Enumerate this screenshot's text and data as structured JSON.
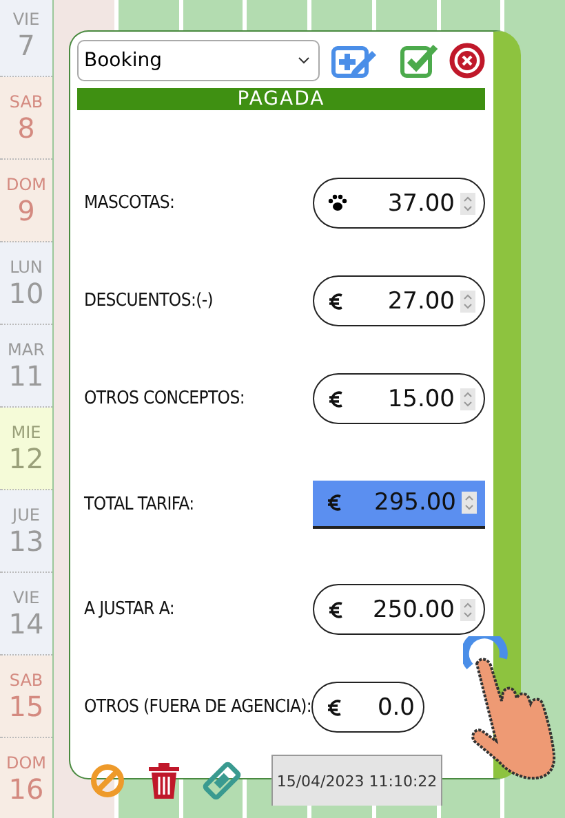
{
  "calendar": {
    "days": [
      {
        "weekday": "VIE",
        "number": "7",
        "kind": "weekday"
      },
      {
        "weekday": "SAB",
        "number": "8",
        "kind": "weekend"
      },
      {
        "weekday": "DOM",
        "number": "9",
        "kind": "weekend"
      },
      {
        "weekday": "LUN",
        "number": "10",
        "kind": "weekday"
      },
      {
        "weekday": "MAR",
        "number": "11",
        "kind": "weekday"
      },
      {
        "weekday": "MIE",
        "number": "12",
        "kind": "today"
      },
      {
        "weekday": "JUE",
        "number": "13",
        "kind": "weekday"
      },
      {
        "weekday": "VIE",
        "number": "14",
        "kind": "weekday"
      },
      {
        "weekday": "SAB",
        "number": "15",
        "kind": "weekend"
      },
      {
        "weekday": "DOM",
        "number": "16",
        "kind": "weekend"
      }
    ]
  },
  "dialog": {
    "source": {
      "value": "Booking"
    },
    "status": "PAGADA",
    "fields": [
      {
        "label": "MASCOTAS:",
        "value": "37.00",
        "kind": "paw"
      },
      {
        "label": "DESCUENTOS:(-)",
        "value": "27.00",
        "kind": "pill"
      },
      {
        "label": "OTROS CONCEPTOS:",
        "value": "15.00",
        "kind": "pill"
      },
      {
        "label": "TOTAL TARIFA:",
        "value": "295.00",
        "kind": "highlight"
      },
      {
        "label": "A JUSTAR A:",
        "value": "250.00",
        "kind": "pill"
      },
      {
        "label": "OTROS (FUERA DE AGENCIA):",
        "value": "0.0",
        "kind": "pill-wide"
      }
    ],
    "timestamp": "15/04/2023 11:10:22"
  }
}
